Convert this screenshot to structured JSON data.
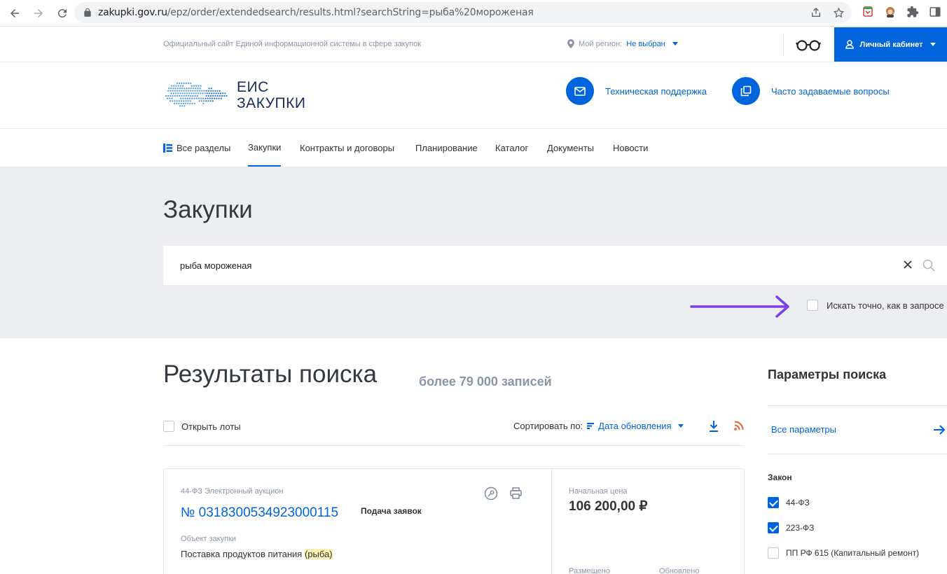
{
  "browser": {
    "url_host": "zakupki.gov.ru",
    "url_path": "/epz/order/extendedsearch/results.html?searchString=рыба%20мороженая"
  },
  "top_strip": {
    "official_text": "Официальный сайт Единой информационной системы в сфере закупок",
    "region_label": "Мой регион:",
    "region_value": "Не выбран",
    "cabinet_label": "Личный кабинет"
  },
  "header": {
    "logo_line1": "ЕИС",
    "logo_line2": "ЗАКУПКИ",
    "support_label": "Техническая поддержка",
    "faq_label": "Часто задаваемые вопросы"
  },
  "nav": {
    "items": [
      "Все разделы",
      "Закупки",
      "Контракты и договоры",
      "Планирование",
      "Каталог",
      "Документы",
      "Новости"
    ],
    "active": "Закупки"
  },
  "search": {
    "page_title": "Закупки",
    "query": "рыба мороженая",
    "exact_label": "Искать точно, как в запросе",
    "exact_checked": false
  },
  "results": {
    "title": "Результаты поиска",
    "count": "более 79 000 записей",
    "open_lots_label": "Открыть лоты",
    "sort_label": "Сортировать по:",
    "sort_value": "Дата обновления"
  },
  "card": {
    "type": "44-ФЗ Электронный аукцион",
    "number": "№ 0318300534923000115",
    "status": "Подача заявок",
    "object_label": "Объект закупки",
    "object_text_before": "Поставка продуктов питания ",
    "object_highlight": "(рыба)",
    "price_label": "Начальная цена",
    "price_value": "106 200,00 ₽",
    "placed_label": "Размещено",
    "updated_label": "Обновлено"
  },
  "sidebar": {
    "title": "Параметры поиска",
    "all_params": "Все параметры",
    "law_title": "Закон",
    "laws": [
      {
        "label": "44-ФЗ",
        "checked": true
      },
      {
        "label": "223-ФЗ",
        "checked": true
      },
      {
        "label": "ПП РФ 615 (Капитальный ремонт)",
        "checked": false
      }
    ]
  },
  "colors": {
    "accent": "#0065dd",
    "annotation_arrow": "#7b3fe4",
    "search_bg": "#eceef1"
  }
}
